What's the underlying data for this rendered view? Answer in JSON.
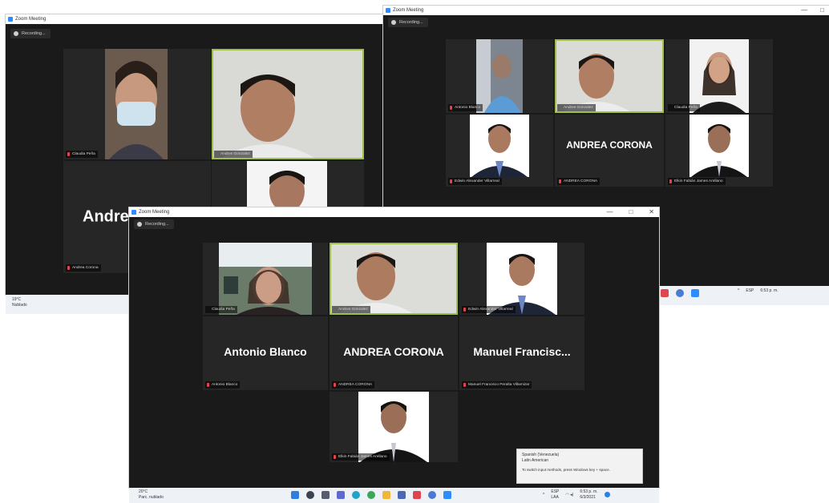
{
  "colors": {
    "meeting_bg": "#1a1a1a",
    "tile_bg": "#262626",
    "active_speaker_border": "#9fc048",
    "zoom_blue": "#2d8cff",
    "taskbar_bg": "#eef1f5",
    "muted_mic": "#e0454b"
  },
  "windows": {
    "back_left": {
      "title": "Zoom Meeting",
      "recording_label": "Recording...",
      "participants": [
        {
          "label": "Claudia Peña"
        },
        {
          "label": "Andres Gonzalez"
        },
        {
          "label": "Andrea Corona",
          "big_name": "Andrea"
        }
      ]
    },
    "back_right": {
      "title": "Zoom Meeting",
      "recording_label": "Recording...",
      "controls": {
        "minimize": "—",
        "maximize": "□"
      },
      "participants": [
        {
          "label": "Antonio Blanco"
        },
        {
          "label": "Andres Gonzalez"
        },
        {
          "label": "Claudia Peña"
        },
        {
          "label": "Edwin Alexander Villarreal"
        },
        {
          "label": "ANDREA CORONA",
          "big_name": "ANDREA CORONA"
        },
        {
          "label": "Elkin Fabián James Arellano"
        }
      ]
    },
    "front": {
      "title": "Zoom Meeting",
      "recording_label": "Recording...",
      "controls": {
        "minimize": "—",
        "maximize": "□",
        "close": "✕"
      },
      "participants": [
        {
          "label": "Claudia Peña"
        },
        {
          "label": "Andres Gonzalez"
        },
        {
          "label": "Edwin Alexander Villarreal"
        },
        {
          "label": "Antonio Blanco",
          "big_name": "Antonio Blanco"
        },
        {
          "label": "ANDREA CORONA",
          "big_name": "ANDREA CORONA"
        },
        {
          "label": "Manuel Francisco Peralta Villamizar",
          "big_name": "Manuel  Francisc..."
        },
        {
          "label": "Elkin Fabián James Arellano"
        }
      ]
    }
  },
  "taskbar_back": {
    "weather_temp": "19°C",
    "weather_desc": "Nublado",
    "tray_lang": "ESP",
    "tray_time": "6:53 p. m."
  },
  "taskbar_front": {
    "weather_temp": "20°C",
    "weather_desc": "Parc. nublado",
    "tray_lang": "ESP",
    "tray_region": "LAA",
    "tray_time": "6:53 p. m.",
    "tray_date": "6/3/2021"
  },
  "ime_popup": {
    "line1": "Spanish (Venezuela)",
    "line2": "Latin American",
    "line3": "To switch input methods, press Windows key + space."
  }
}
